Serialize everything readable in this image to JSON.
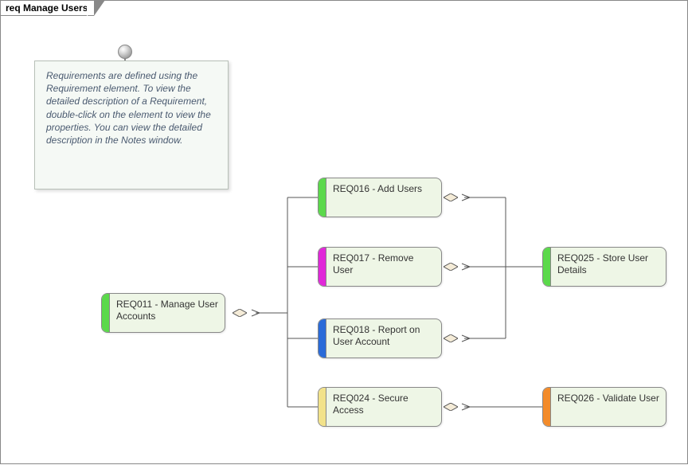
{
  "frame": {
    "title": "req Manage Users"
  },
  "note": {
    "text": "Requirements are defined using the Requirement element.  To view the detailed description of a Requirement, double-click on the element to view the properties.  You can view the detailed description in the Notes window."
  },
  "requirements": {
    "req011": {
      "label": "REQ011 - Manage User Accounts",
      "stripeColor": "#5bd94b"
    },
    "req016": {
      "label": "REQ016 - Add Users",
      "stripeColor": "#5bd94b"
    },
    "req017": {
      "label": "REQ017 - Remove User",
      "stripeColor": "#e028d8"
    },
    "req018": {
      "label": "REQ018 - Report on User Account",
      "stripeColor": "#2a6bd8"
    },
    "req024": {
      "label": "REQ024 - Secure Access",
      "stripeColor": "#f2e28a"
    },
    "req025": {
      "label": "REQ025 - Store User Details",
      "stripeColor": "#5bd94b"
    },
    "req026": {
      "label": "REQ026 - Validate User",
      "stripeColor": "#f38b2a"
    }
  },
  "chart_data": {
    "type": "table",
    "title": "req Manage Users",
    "nodes": [
      {
        "id": "REQ011",
        "label": "REQ011 - Manage User Accounts",
        "color": "green"
      },
      {
        "id": "REQ016",
        "label": "REQ016 - Add Users",
        "color": "green"
      },
      {
        "id": "REQ017",
        "label": "REQ017 - Remove User",
        "color": "magenta"
      },
      {
        "id": "REQ018",
        "label": "REQ018 - Report on User Account",
        "color": "blue"
      },
      {
        "id": "REQ024",
        "label": "REQ024 - Secure Access",
        "color": "yellow"
      },
      {
        "id": "REQ025",
        "label": "REQ025 - Store User Details",
        "color": "green"
      },
      {
        "id": "REQ026",
        "label": "REQ026 - Validate User",
        "color": "orange"
      }
    ],
    "edges": [
      {
        "from": "REQ016",
        "to": "REQ011",
        "type": "aggregation"
      },
      {
        "from": "REQ017",
        "to": "REQ011",
        "type": "aggregation"
      },
      {
        "from": "REQ018",
        "to": "REQ011",
        "type": "aggregation"
      },
      {
        "from": "REQ024",
        "to": "REQ011",
        "type": "aggregation"
      },
      {
        "from": "REQ025",
        "to": "REQ016",
        "type": "aggregation"
      },
      {
        "from": "REQ025",
        "to": "REQ017",
        "type": "aggregation"
      },
      {
        "from": "REQ025",
        "to": "REQ018",
        "type": "aggregation"
      },
      {
        "from": "REQ026",
        "to": "REQ024",
        "type": "aggregation"
      }
    ]
  }
}
